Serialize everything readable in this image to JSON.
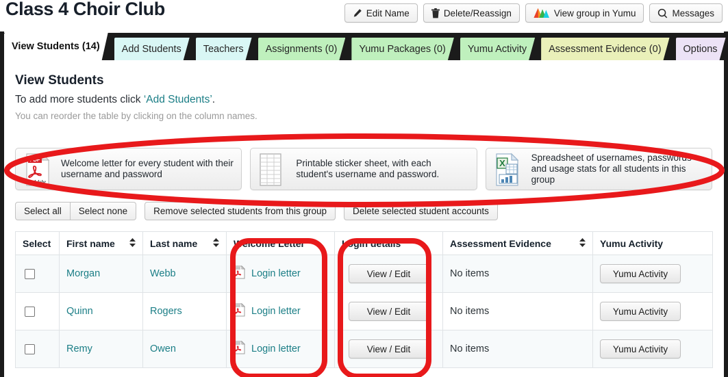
{
  "header": {
    "title": "Class 4 Choir Club",
    "actions": [
      {
        "label": "Edit Name",
        "icon": "pencil-icon"
      },
      {
        "label": "Delete/Reassign",
        "icon": "trash-icon"
      },
      {
        "label": "View group in Yumu",
        "icon": "yumu-logo-icon"
      },
      {
        "label": "Messages",
        "icon": "search-icon"
      }
    ]
  },
  "tabs": [
    {
      "label": "View Students (14)",
      "color": "active",
      "active": true
    },
    {
      "label": "Add Students",
      "color": "cyan",
      "active": false
    },
    {
      "label": "Teachers",
      "color": "cyan",
      "active": false
    },
    {
      "label": "Assignments (0)",
      "color": "green",
      "active": false
    },
    {
      "label": "Yumu Packages (0)",
      "color": "green",
      "active": false
    },
    {
      "label": "Yumu Activity",
      "color": "green",
      "active": false
    },
    {
      "label": "Assessment Evidence (0)",
      "color": "yellow",
      "active": false
    },
    {
      "label": "Options",
      "color": "lilac",
      "active": false
    }
  ],
  "main": {
    "heading": "View Students",
    "add_prefix": "To add more students click ",
    "add_link": "‘Add Students’",
    "add_suffix": ".",
    "reorder_hint": "You can reorder the table by clicking on the column names."
  },
  "cards": [
    {
      "icon": "pdf-file-icon",
      "label": "Welcome letter for every student with their username and password"
    },
    {
      "icon": "sticker-sheet-icon",
      "label": "Printable sticker sheet, with each student's username and password."
    },
    {
      "icon": "excel-file-icon",
      "label": "Spreadsheet of usernames, passwords and usage stats for all students in this group"
    }
  ],
  "toolbar": {
    "select_all": "Select all",
    "select_none": "Select none",
    "remove_selected": "Remove selected students from this group",
    "delete_selected": "Delete selected student accounts"
  },
  "table": {
    "columns": [
      {
        "label": "Select",
        "sortable": false
      },
      {
        "label": "First name",
        "sortable": true
      },
      {
        "label": "Last name",
        "sortable": true
      },
      {
        "label": "Welcome Letter",
        "sortable": false
      },
      {
        "label": "Login details",
        "sortable": false
      },
      {
        "label": "Assessment Evidence",
        "sortable": true
      },
      {
        "label": "Yumu Activity",
        "sortable": false
      }
    ],
    "rows": [
      {
        "first_name": "Morgan",
        "last_name": "Webb",
        "welcome_letter": "Login letter",
        "login_details": "View / Edit",
        "assessment_evidence": "No items",
        "yumu_activity": "Yumu Activity"
      },
      {
        "first_name": "Quinn",
        "last_name": "Rogers",
        "welcome_letter": "Login letter",
        "login_details": "View / Edit",
        "assessment_evidence": "No items",
        "yumu_activity": "Yumu Activity"
      },
      {
        "first_name": "Remy",
        "last_name": "Owen",
        "welcome_letter": "Login letter",
        "login_details": "View / Edit",
        "assessment_evidence": "No items",
        "yumu_activity": "Yumu Activity"
      }
    ]
  },
  "colors": {
    "link": "#1b7e86",
    "annotation": "#e8191b",
    "tab_cyan": "#d9f7f5",
    "tab_green": "#bff0bd",
    "tab_yellow": "#eaf0b9",
    "tab_lilac": "#ece2f6",
    "tabstrip_bg": "#1b1b1b"
  },
  "annotations": [
    {
      "shape": "ellipse",
      "target": "document-cards-row"
    },
    {
      "shape": "rounded-rect",
      "target": "welcome-letter-column"
    },
    {
      "shape": "rounded-rect",
      "target": "login-details-column"
    }
  ]
}
